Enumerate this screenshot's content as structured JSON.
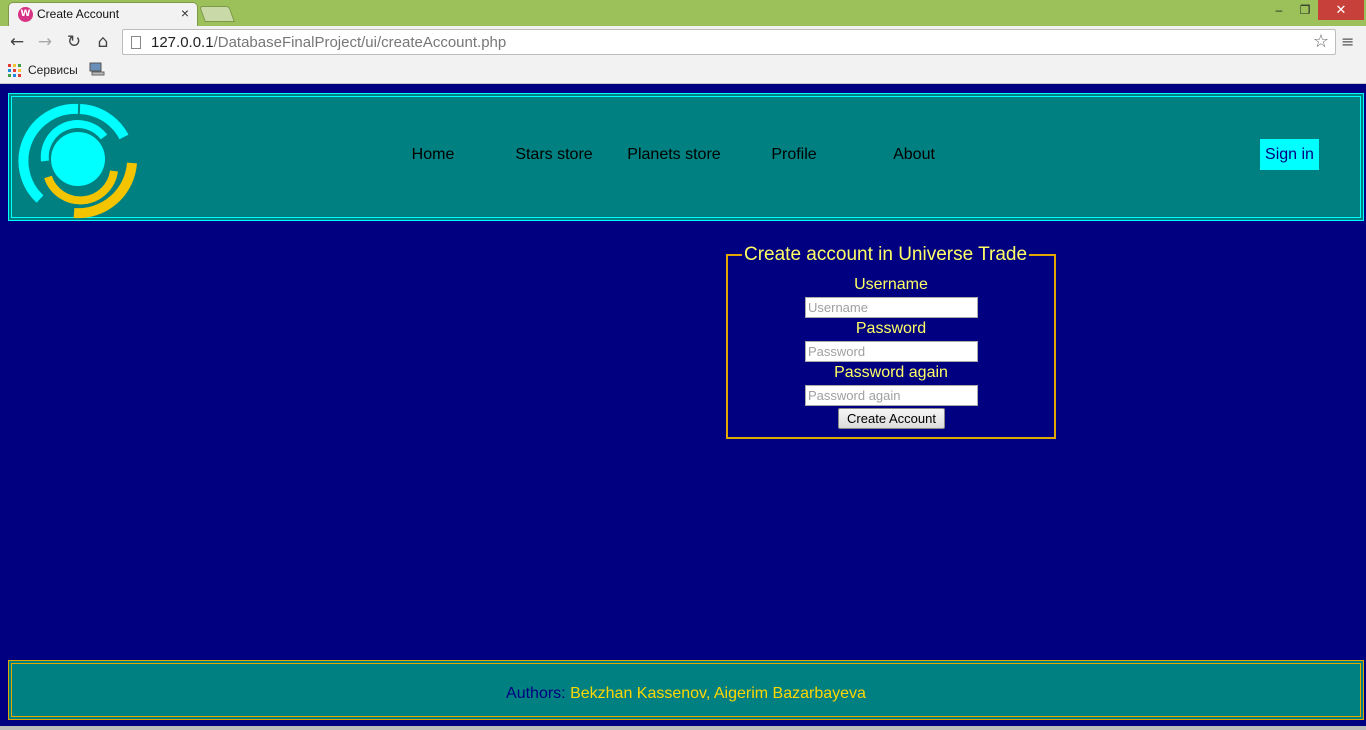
{
  "browser": {
    "tab_title": "Create Account",
    "tab_favicon_letter": "W",
    "tab_close": "×",
    "url_host": "127.0.0.1",
    "url_path": "/DatabaseFinalProject/ui/createAccount.php",
    "bookmarks_apps_label": "Сервисы",
    "window_min": "–",
    "window_max": "❐",
    "window_close": "✕",
    "icons": {
      "back": "←",
      "forward": "→",
      "reload": "↻",
      "home": "⌂",
      "star": "☆",
      "menu": "≡"
    }
  },
  "header": {
    "nav": [
      "Home",
      "Stars store",
      "Planets store",
      "Profile",
      "About"
    ],
    "signin_label": "Sign in"
  },
  "form": {
    "legend": "Create account in Universe Trade",
    "fields": [
      {
        "label": "Username",
        "placeholder": "Username"
      },
      {
        "label": "Password",
        "placeholder": "Password"
      },
      {
        "label": "Password again",
        "placeholder": "Password again"
      }
    ],
    "submit_label": "Create Account"
  },
  "footer": {
    "authors_key": "Authors:",
    "authors_value": "Bekzhan Kassenov, Aigerim Bazarbayeva"
  },
  "colors": {
    "page_background": "#000080",
    "panel_teal": "#008080",
    "accent_cyan": "#00ffff",
    "accent_gold": "#e0a800",
    "label_yellow": "#ffff66",
    "logo_yellow": "#f5c400"
  }
}
